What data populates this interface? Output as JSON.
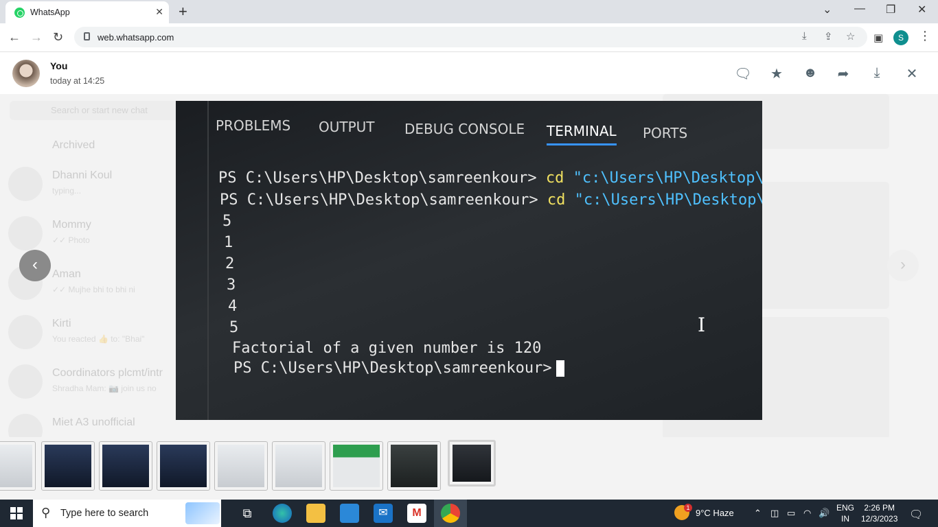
{
  "browser": {
    "tab_title": "WhatsApp",
    "url": "web.whatsapp.com",
    "profile_initial": "S"
  },
  "viewer": {
    "sender": "You",
    "timestamp": "today at 14:25"
  },
  "photo": {
    "panel_tabs": [
      "PROBLEMS",
      "OUTPUT",
      "DEBUG CONSOLE",
      "TERMINAL",
      "PORTS"
    ],
    "active_tab": "TERMINAL",
    "prompt1": "PS C:\\Users\\HP\\Desktop\\samreenkour>",
    "cmd1": "cd",
    "arg1": "\"c:\\Users\\HP\\Desktop\\s",
    "prompt2": "PS C:\\Users\\HP\\Desktop\\samreenkour>",
    "cmd2": "cd",
    "arg2": "\"c:\\Users\\HP\\Desktop\\sa",
    "output": [
      "5",
      "1",
      "2",
      "3",
      "4",
      "5"
    ],
    "result": "Factorial of a given number is 120",
    "prompt3": "PS C:\\Users\\HP\\Desktop\\samreenkour>"
  },
  "background_chats": [
    {
      "name": "Archived",
      "sub": ""
    },
    {
      "name": "Dhanni Koul",
      "sub": "typing..."
    },
    {
      "name": "Mommy",
      "sub": "✓✓ Photo"
    },
    {
      "name": "Aman",
      "sub": "✓✓ Mujhe bhi to bhi ni"
    },
    {
      "name": "Kirti",
      "sub": "You reacted 👍 to: \"Bhai\""
    },
    {
      "name": "Coordinators plcmt/intr",
      "sub": "Shradha Mam: 📷 join us no"
    },
    {
      "name": "Miet A3 unofficial",
      "sub": ""
    }
  ],
  "background_search_placeholder": "Search or start new chat",
  "taskbar": {
    "search_placeholder": "Type here to search",
    "weather": "9°C  Haze",
    "weather_badge": "1",
    "lang_top": "ENG",
    "lang_bottom": "IN",
    "time": "2:26 PM",
    "date": "12/3/2023"
  },
  "icons": {
    "tab_close": "✕",
    "new_tab": "+",
    "back": "←",
    "forward": "→",
    "reload": "↻",
    "prev": "‹",
    "next": "›",
    "close_viewer": "✕"
  }
}
